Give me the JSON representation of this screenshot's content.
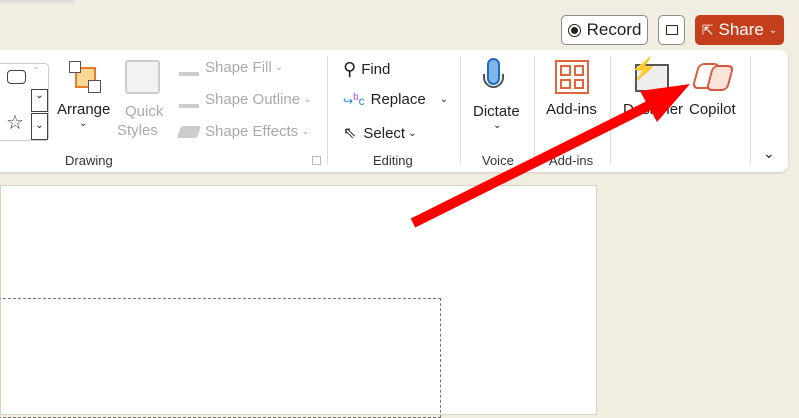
{
  "header": {
    "record": "Record",
    "share": "Share"
  },
  "ribbon": {
    "drawing": {
      "arrange": "Arrange",
      "quick_styles_1": "Quick",
      "quick_styles_2": "Styles",
      "shape_fill": "Shape Fill",
      "shape_outline": "Shape Outline",
      "shape_effects": "Shape Effects",
      "group": "Drawing"
    },
    "editing": {
      "find": "Find",
      "replace": "Replace",
      "select": "Select",
      "group": "Editing"
    },
    "voice": {
      "dictate": "Dictate",
      "group": "Voice"
    },
    "addins": {
      "addins": "Add-ins",
      "group": "Add-ins"
    },
    "designer": "Designer",
    "copilot": "Copilot"
  },
  "colors": {
    "share": "#c43e1c",
    "arrow": "#ff0000",
    "background": "#f1ede0"
  }
}
